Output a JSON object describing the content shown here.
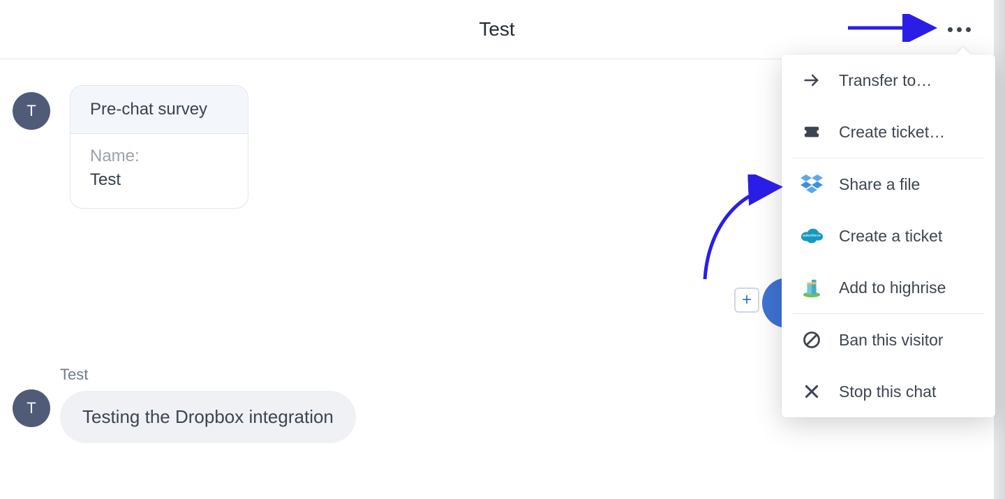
{
  "header": {
    "title": "Test"
  },
  "survey": {
    "heading": "Pre-chat survey",
    "name_label": "Name:",
    "name_value": "Test"
  },
  "message": {
    "sender": "Test",
    "text": "Testing the Dropbox integration",
    "avatar_initial": "T"
  },
  "plus_button_symbol": "+",
  "menu": {
    "items": [
      {
        "label": "Transfer to…"
      },
      {
        "label": "Create ticket…"
      },
      {
        "label": "Share a file"
      },
      {
        "label": "Create a ticket"
      },
      {
        "label": "Add to highrise"
      },
      {
        "label": "Ban this visitor"
      },
      {
        "label": "Stop this chat"
      }
    ]
  },
  "colors": {
    "annotation": "#2a1ee6",
    "avatar_bg": "#4f5b77",
    "bubble_bg": "#eff1f4"
  }
}
